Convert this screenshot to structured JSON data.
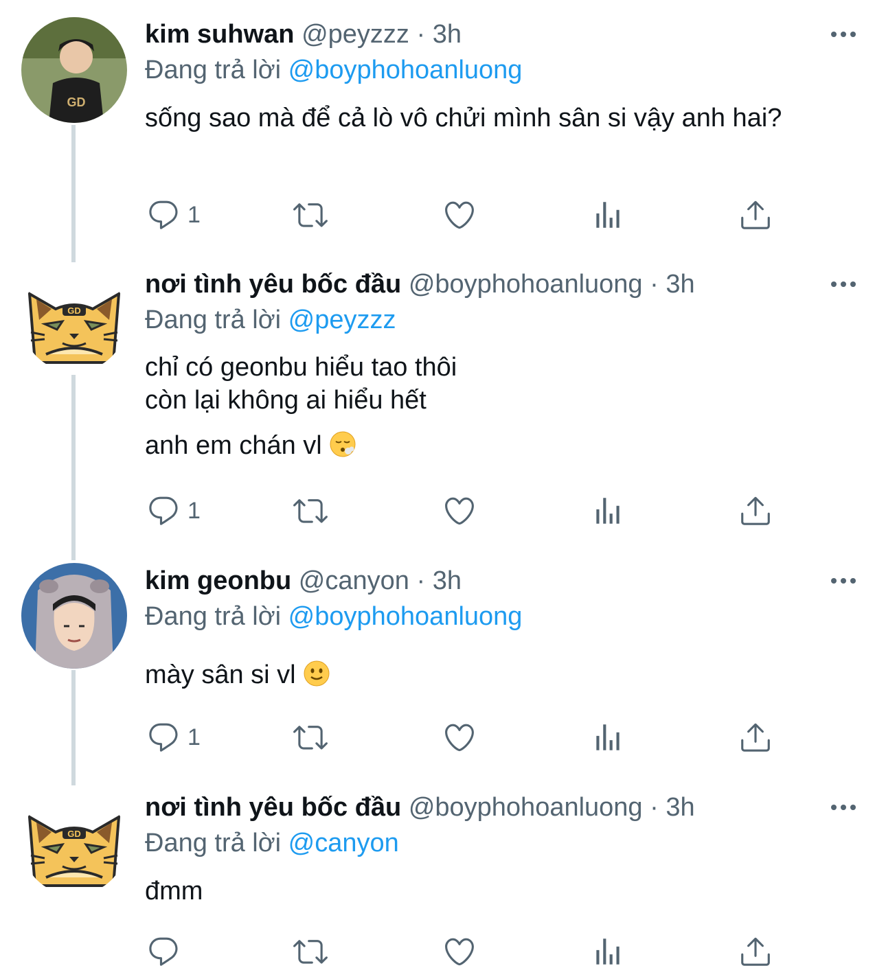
{
  "tweets": [
    {
      "name": "kim suhwan",
      "handle": "@peyzzz",
      "time": "3h",
      "replying_prefix": "Đang trả lời",
      "replying_to": "@boyphohoanluong",
      "lines": [
        "sống sao mà để cả lò vô chửi mình sân si vậy anh hai?"
      ],
      "emoji": "",
      "reply_count": "1",
      "avatar": "player-photo"
    },
    {
      "name": "nơi tình yêu bốc đầu",
      "handle": "@boyphohoanluong",
      "time": "3h",
      "replying_prefix": "Đang trả lời",
      "replying_to": "@peyzzz",
      "lines": [
        "chỉ có geonbu hiểu tao thôi",
        "còn lại không ai hiểu hết",
        "anh em chán vl"
      ],
      "emoji": "😮‍💨",
      "reply_count": "1",
      "avatar": "tiger-mascot"
    },
    {
      "name": "kim geonbu",
      "handle": "@canyon",
      "time": "3h",
      "replying_prefix": "Đang trả lời",
      "replying_to": "@boyphohoanluong",
      "lines": [
        "mày sân si vl"
      ],
      "emoji": "🙂",
      "reply_count": "1",
      "avatar": "player-hood-photo"
    },
    {
      "name": "nơi tình yêu bốc đầu",
      "handle": "@boyphohoanluong",
      "time": "3h",
      "replying_prefix": "Đang trả lời",
      "replying_to": "@canyon",
      "lines": [
        "đmm"
      ],
      "emoji": "",
      "reply_count": "",
      "avatar": "tiger-mascot"
    }
  ],
  "separator": "·",
  "colors": {
    "text": "#0f1419",
    "secondary": "#536471",
    "link": "#1d9bf0",
    "thread_line": "#cfd9de",
    "mascot_yellow": "#f4c35a"
  },
  "icons": [
    "reply-icon",
    "retweet-icon",
    "like-icon",
    "analytics-icon",
    "share-icon",
    "more-icon"
  ]
}
